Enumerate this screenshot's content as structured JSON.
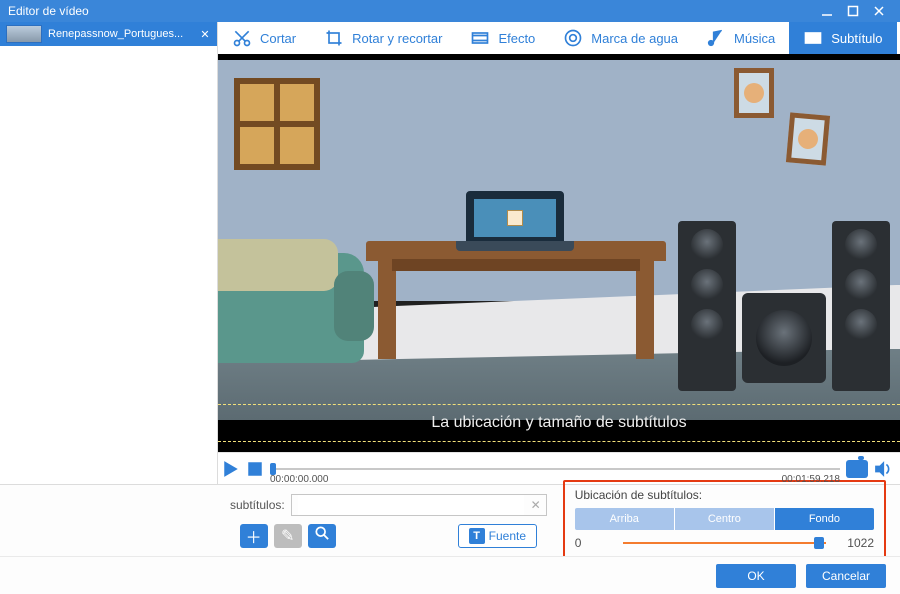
{
  "window": {
    "title": "Editor de vídeo"
  },
  "file_tab": {
    "name": "Renepassnow_Portugues..."
  },
  "toolbar": {
    "cut": {
      "label": "Cortar"
    },
    "rotate": {
      "label": "Rotar y recortar"
    },
    "effect": {
      "label": "Efecto"
    },
    "watermark": {
      "label": "Marca de agua"
    },
    "music": {
      "label": "Música"
    },
    "subtitle": {
      "label": "Subtítulo"
    }
  },
  "preview": {
    "subtitle_sample": "La ubicación y tamaño de subtítulos"
  },
  "playback": {
    "current": "00:00:00.000",
    "total": "00:01:59.218"
  },
  "subtitle_panel": {
    "field_label": "subtítulos:",
    "field_value": "",
    "field_placeholder": "",
    "font_button": "Fuente",
    "position": {
      "label": "Ubicación de subtítulos:",
      "options": {
        "top": "Arriba",
        "center": "Centro",
        "bottom": "Fondo"
      },
      "selected": "bottom",
      "slider_min": "0",
      "slider_value": "1022"
    }
  },
  "footer": {
    "ok": "OK",
    "cancel": "Cancelar"
  }
}
